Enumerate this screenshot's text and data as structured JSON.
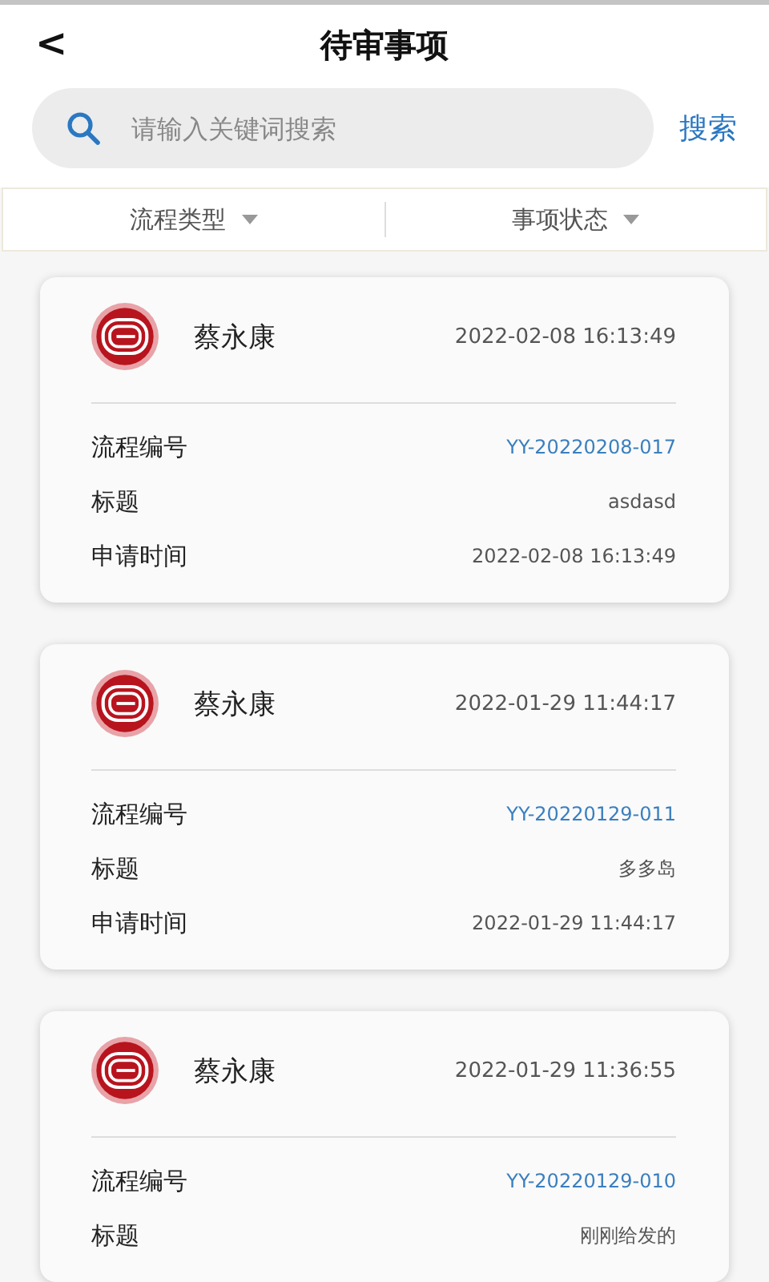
{
  "header": {
    "back": "<",
    "title": "待审事项"
  },
  "search": {
    "placeholder": "请输入关键词搜索",
    "button": "搜索"
  },
  "filters": [
    {
      "label": "流程类型"
    },
    {
      "label": "事项状态"
    }
  ],
  "items": [
    {
      "name": "蔡永康",
      "time": "2022-02-08 16:13:49",
      "fields": [
        {
          "label": "流程编号",
          "value": "YY-20220208-017",
          "kind": "link"
        },
        {
          "label": "标题",
          "value": "asdasd",
          "kind": "text"
        },
        {
          "label": "申请时间",
          "value": "2022-02-08 16:13:49",
          "kind": "text"
        }
      ]
    },
    {
      "name": "蔡永康",
      "time": "2022-01-29 11:44:17",
      "fields": [
        {
          "label": "流程编号",
          "value": "YY-20220129-011",
          "kind": "link"
        },
        {
          "label": "标题",
          "value": "多多岛",
          "kind": "text"
        },
        {
          "label": "申请时间",
          "value": "2022-01-29 11:44:17",
          "kind": "text"
        }
      ]
    },
    {
      "name": "蔡永康",
      "time": "2022-01-29 11:36:55",
      "fields": [
        {
          "label": "流程编号",
          "value": "YY-20220129-010",
          "kind": "link"
        },
        {
          "label": "标题",
          "value": "刚刚给发的",
          "kind": "text"
        }
      ]
    }
  ]
}
